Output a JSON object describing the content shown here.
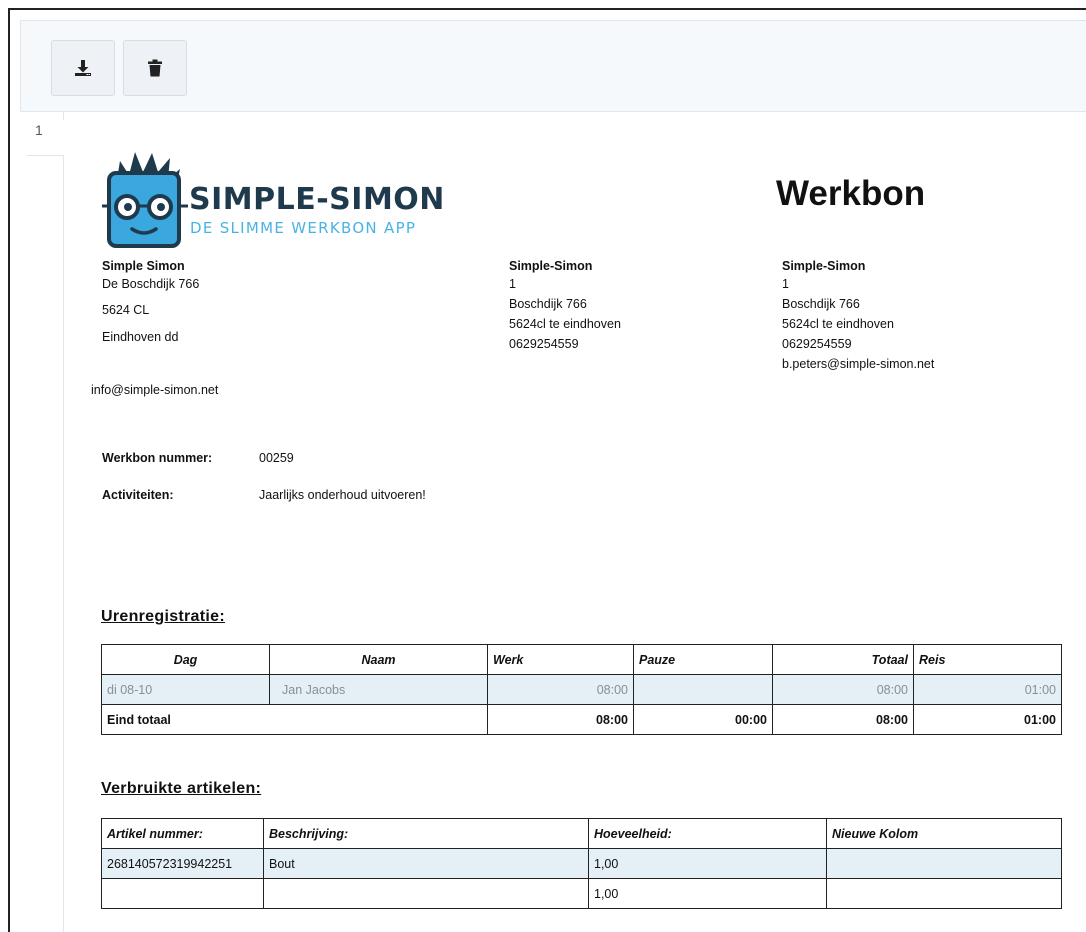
{
  "toolbar": {
    "download_icon": "download-icon",
    "delete_icon": "trash-icon"
  },
  "page_number": "1",
  "logo": {
    "name": "SIMPLE-SIMON",
    "tagline": "DE SLIMME WERKBON APP"
  },
  "doc_title": "Werkbon",
  "sender": {
    "name": "Simple Simon",
    "street": "De Boschdijk 766",
    "postcode": "5624 CL",
    "city": "Eindhoven dd",
    "email": "info@simple-simon.net"
  },
  "address_a": {
    "name": "Simple-Simon",
    "line1": "1",
    "street": "Boschdijk 766",
    "city": "5624cl te eindhoven",
    "phone": "0629254559"
  },
  "address_b": {
    "name": "Simple-Simon",
    "line1": "1",
    "street": "Boschdijk 766",
    "city": "5624cl te eindhoven",
    "phone": "0629254559",
    "email": "b.peters@simple-simon.net"
  },
  "details": {
    "number_label": "Werkbon nummer:",
    "number_value": "00259",
    "activities_label": "Activiteiten:",
    "activities_value": "Jaarlijks onderhoud uitvoeren!"
  },
  "hours": {
    "title": "Urenregistratie:",
    "headers": [
      "Dag",
      "Naam",
      "Werk",
      "Pauze",
      "Totaal",
      "Reis"
    ],
    "row": {
      "dag": "di 08-10",
      "naam": "Jan Jacobs",
      "werk": "08:00",
      "pauze": "",
      "totaal": "08:00",
      "reis": "01:00"
    },
    "total": {
      "label": "Eind totaal",
      "werk": "08:00",
      "pauze": "00:00",
      "totaal": "08:00",
      "reis": "01:00"
    }
  },
  "articles": {
    "title": "Verbruikte artikelen:",
    "headers": [
      "Artikel nummer:",
      "Beschrijving:",
      "Hoeveelheid:",
      "Nieuwe Kolom"
    ],
    "rows": [
      {
        "nummer": "268140572319942251",
        "beschrijving": "Bout",
        "hoeveelheid": "1,00",
        "nieuw": ""
      },
      {
        "nummer": "",
        "beschrijving": "",
        "hoeveelheid": "1,00",
        "nieuw": ""
      }
    ]
  }
}
